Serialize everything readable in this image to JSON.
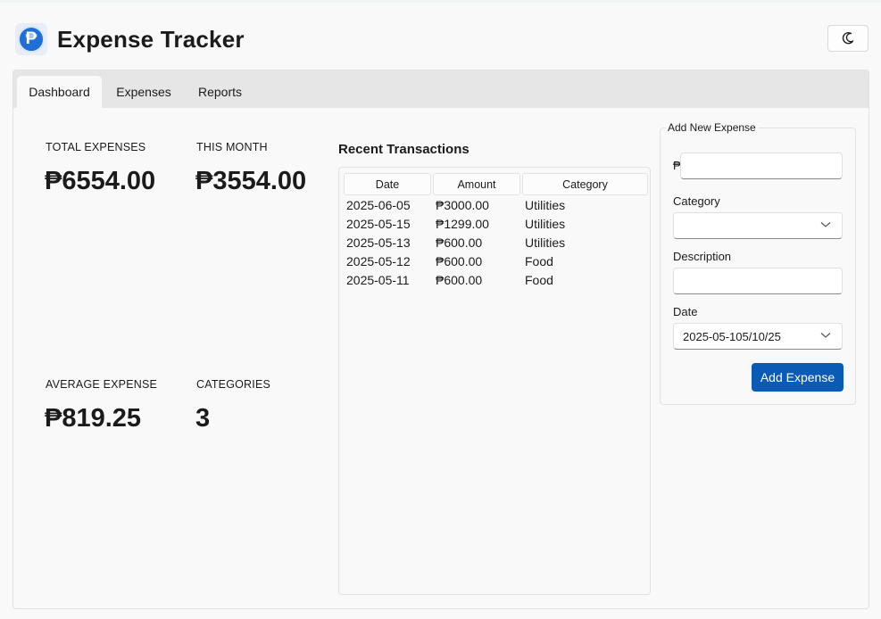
{
  "app": {
    "title": "Expense Tracker",
    "logo_icon": "peso-coin-icon",
    "theme_icon": "moon-icon"
  },
  "tabs": [
    {
      "label": "Dashboard",
      "active": true
    },
    {
      "label": "Expenses",
      "active": false
    },
    {
      "label": "Reports",
      "active": false
    }
  ],
  "stats": {
    "total": {
      "label": "TOTAL EXPENSES",
      "value": "₱6554.00"
    },
    "month": {
      "label": "THIS MONTH",
      "value": "₱3554.00"
    },
    "average": {
      "label": "AVERAGE EXPENSE",
      "value": "₱819.25"
    },
    "categories": {
      "label": "CATEGORIES",
      "value": "3"
    }
  },
  "transactions": {
    "title": "Recent Transactions",
    "columns": [
      "Date",
      "Amount",
      "Category"
    ],
    "rows": [
      {
        "date": "2025-06-05",
        "amount": "₱3000.00",
        "category": "Utilities"
      },
      {
        "date": "2025-05-15",
        "amount": "₱1299.00",
        "category": "Utilities"
      },
      {
        "date": "2025-05-13",
        "amount": "₱600.00",
        "category": "Utilities"
      },
      {
        "date": "2025-05-12",
        "amount": "₱600.00",
        "category": "Food"
      },
      {
        "date": "2025-05-11",
        "amount": "₱600.00",
        "category": "Food"
      }
    ]
  },
  "form": {
    "legend": "Add New Expense",
    "currency_symbol": "₱",
    "amount_value": "",
    "category_label": "Category",
    "category_value": "",
    "description_label": "Description",
    "description_value": "",
    "date_label": "Date",
    "date_value": "2025-05-105/10/25",
    "submit_label": "Add Expense"
  },
  "colors": {
    "accent": "#0a5bb5",
    "logo": "#1f6fd6",
    "tabbar": "#e6e6e6"
  }
}
